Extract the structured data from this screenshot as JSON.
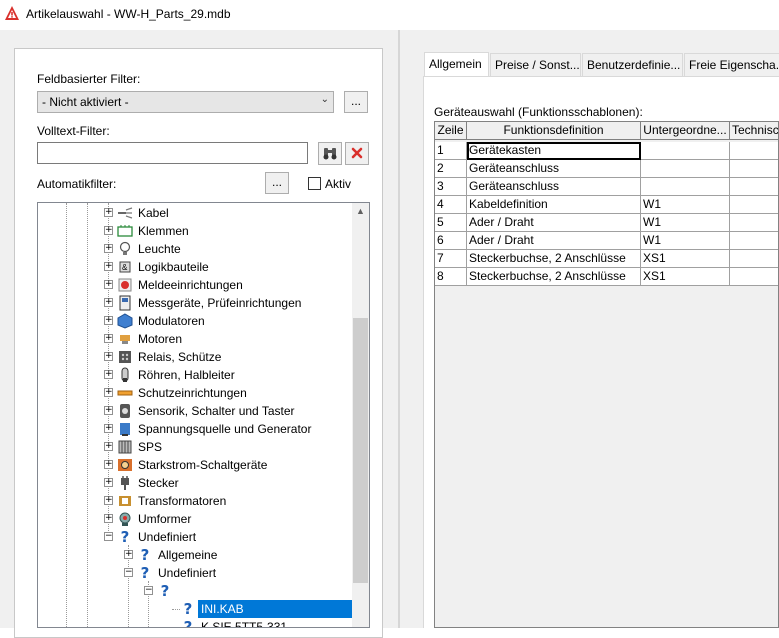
{
  "window": {
    "title": "Artikelauswahl - WW-H_Parts_29.mdb",
    "icon": "warning-triangle-icon"
  },
  "filter": {
    "field_label": "Feldbasierter Filter:",
    "field_value": "- Nicht aktiviert -",
    "field_button": "...",
    "fulltext_label": "Volltext-Filter:",
    "fulltext_value": "",
    "auto_label": "Automatikfilter:",
    "auto_button": "...",
    "active_label": "Aktiv",
    "active_checked": false
  },
  "tree": {
    "items": [
      {
        "label": "Kabel",
        "icon": "cable-icon",
        "expander": "+"
      },
      {
        "label": "Klemmen",
        "icon": "terminal-icon",
        "expander": "+"
      },
      {
        "label": "Leuchte",
        "icon": "lamp-icon",
        "expander": "+"
      },
      {
        "label": "Logikbauteile",
        "icon": "logic-icon",
        "expander": "+"
      },
      {
        "label": "Meldeeinrichtungen",
        "icon": "signal-icon",
        "expander": "+"
      },
      {
        "label": "Messgeräte, Prüfeinrichtungen",
        "icon": "meter-icon",
        "expander": "+"
      },
      {
        "label": "Modulatoren",
        "icon": "modulator-icon",
        "expander": "+"
      },
      {
        "label": "Motoren",
        "icon": "motor-icon",
        "expander": "+"
      },
      {
        "label": "Relais, Schütze",
        "icon": "relay-icon",
        "expander": "+"
      },
      {
        "label": "Röhren, Halbleiter",
        "icon": "tube-icon",
        "expander": "+"
      },
      {
        "label": "Schutzeinrichtungen",
        "icon": "fuse-icon",
        "expander": "+"
      },
      {
        "label": "Sensorik, Schalter und Taster",
        "icon": "switch-icon",
        "expander": "+"
      },
      {
        "label": "Spannungsquelle und Generator",
        "icon": "generator-icon",
        "expander": "+"
      },
      {
        "label": "SPS",
        "icon": "plc-icon",
        "expander": "+"
      },
      {
        "label": "Starkstrom-Schaltgeräte",
        "icon": "power-switch-icon",
        "expander": "+"
      },
      {
        "label": "Stecker",
        "icon": "plug-icon",
        "expander": "+"
      },
      {
        "label": "Transformatoren",
        "icon": "transformer-icon",
        "expander": "+"
      },
      {
        "label": "Umformer",
        "icon": "converter-icon",
        "expander": "+"
      },
      {
        "label": "Undefiniert",
        "icon": "question-icon",
        "expander": "−"
      },
      {
        "label": "Allgemeine",
        "icon": "question-icon",
        "expander": "+"
      },
      {
        "label": "Undefiniert",
        "icon": "question-icon",
        "expander": "−"
      },
      {
        "label": "",
        "icon": "question-icon",
        "expander": "−"
      },
      {
        "label": "INI.KAB",
        "icon": "question-icon",
        "expander": ""
      },
      {
        "label": "K SIE 5TT5-331",
        "icon": "question-icon",
        "expander": ""
      }
    ]
  },
  "tabs": [
    "Allgemein",
    "Preise / Sonst...",
    "Benutzerdefinie...",
    "Freie Eigenscha..."
  ],
  "grid": {
    "label": "Geräteauswahl (Funktionsschablonen):",
    "headers": [
      "Zeile",
      "Funktionsdefinition",
      "Untergeordne...",
      "Technisc"
    ],
    "rows": [
      {
        "num": "1",
        "func": "Gerätekasten",
        "sub": ""
      },
      {
        "num": "2",
        "func": "Geräteanschluss",
        "sub": ""
      },
      {
        "num": "3",
        "func": "Geräteanschluss",
        "sub": ""
      },
      {
        "num": "4",
        "func": "Kabeldefinition",
        "sub": "W1"
      },
      {
        "num": "5",
        "func": "Ader / Draht",
        "sub": "W1"
      },
      {
        "num": "6",
        "func": "Ader / Draht",
        "sub": "W1"
      },
      {
        "num": "7",
        "func": "Steckerbuchse, 2 Anschlüsse",
        "sub": "XS1"
      },
      {
        "num": "8",
        "func": "Steckerbuchse, 2 Anschlüsse",
        "sub": "XS1"
      }
    ]
  },
  "colors": {
    "selection": "#0078d7",
    "accent_red": "#d9302c",
    "question_blue": "#1f5fb5"
  }
}
